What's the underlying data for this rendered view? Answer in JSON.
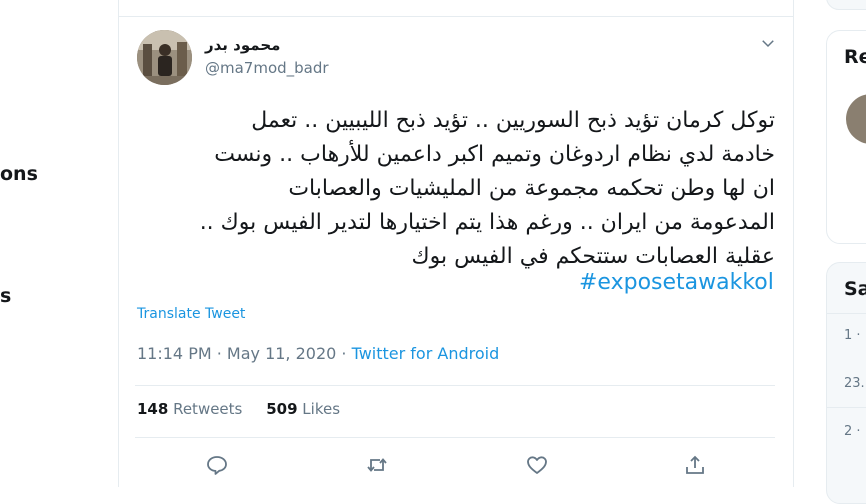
{
  "left_nav": {
    "fragment_1": "ons",
    "fragment_2": "s"
  },
  "tweet": {
    "author_name": "محمود بدر",
    "author_handle": "@ma7mod_badr",
    "text_lines": [
      "توكل كرمان تؤيد ذبح السوريين .. تؤيد ذبح الليبيين .. تعمل",
      "خادمة لدي نظام اردوغان وتميم اكبر داعمين للأرهاب .. ونست",
      "ان لها وطن تحكمه مجموعة من المليشيات والعصابات",
      "المدعومة من ايران .. ورغم هذا يتم اختيارها لتدير الفيس بوك ..",
      "عقلية العصابات ستتحكم في الفيس بوك"
    ],
    "hashtag": "#exposetawakkol",
    "translate_label": "Translate Tweet",
    "timestamp": "11:14 PM · May 11, 2020 · ",
    "source": "Twitter for Android",
    "retweets_count": "148",
    "retweets_label": " Retweets",
    "likes_count": "509",
    "likes_label": " Likes"
  },
  "actions": {
    "reply_icon": "reply-icon",
    "retweet_icon": "retweet-icon",
    "like_icon": "heart-icon",
    "share_icon": "share-icon"
  },
  "right_sidebar": {
    "card1_title": "Re",
    "card2_title": "Sa",
    "items": [
      "1 ·",
      "23.",
      "2 ·"
    ]
  },
  "colors": {
    "accent": "#1b95e0",
    "muted": "#657786",
    "border": "#e6ecf0"
  }
}
